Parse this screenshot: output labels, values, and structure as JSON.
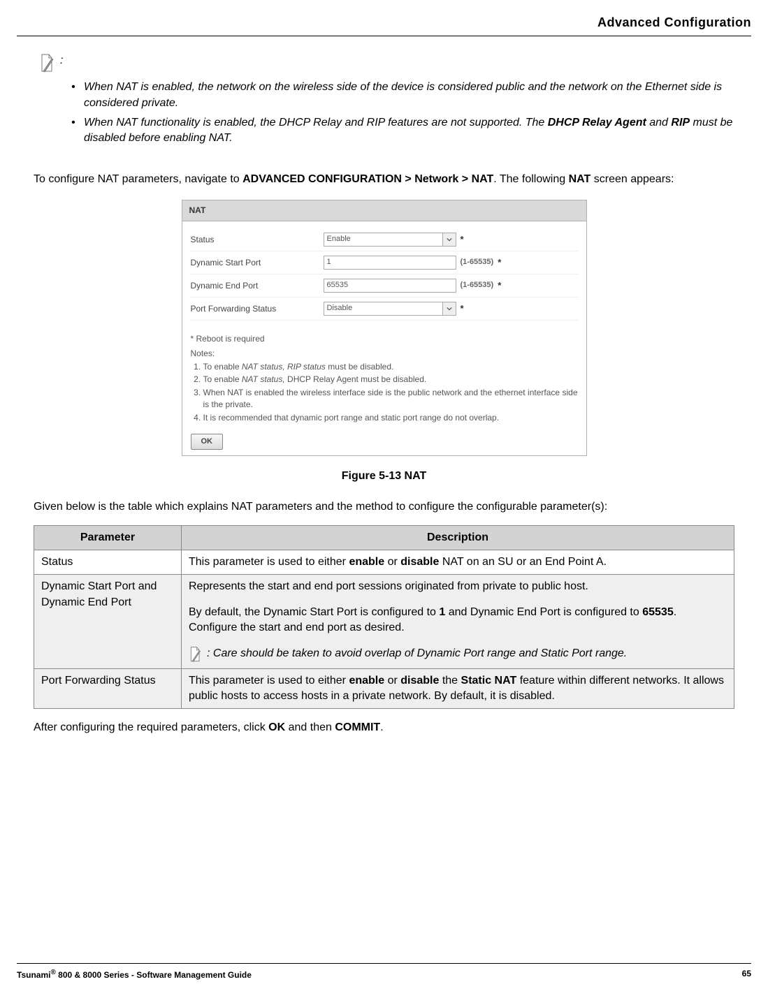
{
  "header": {
    "section_title": "Advanced Configuration"
  },
  "note_top": {
    "colon": ":",
    "bullets": [
      {
        "pre": "When NAT is enabled, the network on the wireless side of the device is considered public and the network on the Ethernet side is considered private."
      },
      {
        "pre": "When NAT functionality is enabled, the DHCP Relay and RIP features are not supported. The ",
        "b1": "DHCP Relay Agent",
        "mid": " and ",
        "b2": "RIP",
        "post": " must be disabled before enabling NAT."
      }
    ]
  },
  "nav_text": {
    "pre": "To configure NAT parameters, navigate to ",
    "path": "ADVANCED CONFIGURATION > Network > NAT",
    "mid": ". The following ",
    "bold": "NAT",
    "post": " screen appears:"
  },
  "panel": {
    "title": "NAT",
    "rows": {
      "status": {
        "label": "Status",
        "value": "Enable",
        "asterisk": "*"
      },
      "dstart": {
        "label": "Dynamic Start Port",
        "value": "1",
        "hint": "(1-65535)",
        "asterisk": "*"
      },
      "dend": {
        "label": "Dynamic End Port",
        "value": "65535",
        "hint": "(1-65535)",
        "asterisk": "*"
      },
      "pfwd": {
        "label": "Port Forwarding Status",
        "value": "Disable",
        "asterisk": "*"
      }
    },
    "reboot": "* Reboot is required",
    "notes_label": "Notes:",
    "notes": [
      {
        "pre": "To enable ",
        "i1": "NAT status, RIP status",
        "post": " must be disabled."
      },
      {
        "pre": "To enable ",
        "i1": "NAT status,",
        "post": " DHCP Relay Agent must be disabled."
      },
      {
        "text": "When NAT is enabled the wireless interface side is the public network and the ethernet interface side is the private."
      },
      {
        "text": "It is recommended that dynamic port range and static port range do not overlap."
      }
    ],
    "ok": "OK"
  },
  "figure_caption": "Figure 5-13 NAT",
  "table_intro": "Given below is the table which explains NAT parameters and the method to configure the configurable parameter(s):",
  "table": {
    "headers": {
      "param": "Parameter",
      "desc": "Description"
    },
    "rows": [
      {
        "param": "Status",
        "shade": false,
        "desc": {
          "pre": "This parameter is used to either ",
          "b1": "enable",
          "mid": " or ",
          "b2": "disable",
          "post": " NAT on an SU or an End Point A."
        }
      },
      {
        "param": "Dynamic Start Port and Dynamic End Port",
        "shade": true,
        "desc": {
          "p1": "Represents the start and end port sessions originated from private to public host.",
          "p2_pre": "By default, the Dynamic Start Port is configured to ",
          "p2_b1": "1",
          "p2_mid": " and Dynamic End Port is configured to ",
          "p2_b2": "65535",
          "p2_post": ". Configure the start and end port as desired.",
          "note_colon": ": ",
          "note": "Care should be taken to avoid overlap of Dynamic Port range and Static Port range."
        }
      },
      {
        "param": "Port Forwarding Status",
        "shade": true,
        "desc": {
          "pre": "This parameter is used to either ",
          "b1": "enable",
          "mid1": " or ",
          "b2": "disable",
          "mid2": " the ",
          "b3": "Static NAT",
          "post": " feature within different networks. It allows public hosts to access hosts in a private network. By default, it is disabled."
        }
      }
    ]
  },
  "after_table": {
    "pre": "After configuring the required parameters, click ",
    "b1": "OK",
    "mid": " and then ",
    "b2": "COMMIT",
    "post": "."
  },
  "footer": {
    "left_pre": "Tsunami",
    "left_reg": "®",
    "left_post": " 800 & 8000 Series - Software Management Guide",
    "page": "65"
  }
}
